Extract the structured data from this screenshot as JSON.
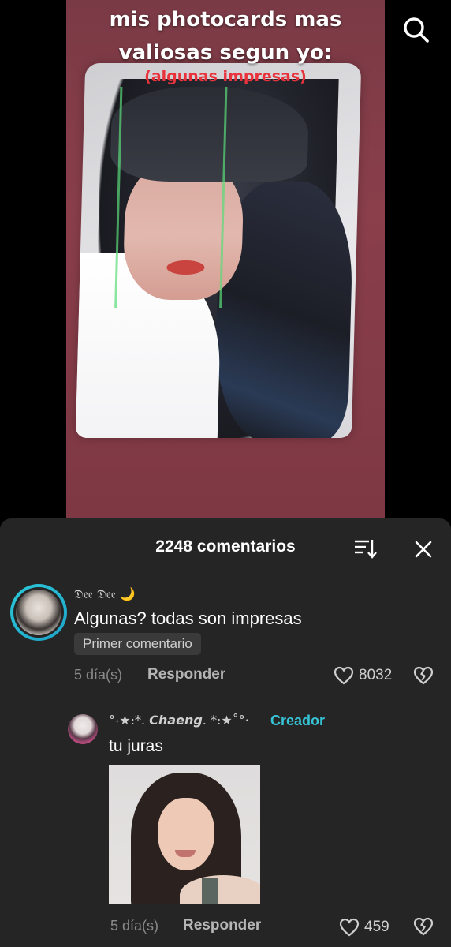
{
  "video": {
    "caption_line1": "mis photocards mas",
    "caption_line2": "valiosas segun yo:",
    "subcaption": "(algunas impresas)",
    "search_icon": "search-icon"
  },
  "comments_sheet": {
    "title": "2248 comentarios",
    "sort_icon": "sort-icon",
    "close_icon": "close-icon",
    "comments": [
      {
        "username": "𝔇𝔢𝔢 𝔇𝔢𝔢 🌙",
        "text": "Algunas? todas son impresas",
        "badge": "Primer comentario",
        "time": "5 día(s)",
        "reply_label": "Responder",
        "likes": "8032"
      },
      {
        "username": "°˖★:*. 𝘾𝙝𝙖𝙚𝙣𝙜. *:★˚°·",
        "creator_label": "Creador",
        "text": "tu juras",
        "time": "5 día(s)",
        "reply_label": "Responder",
        "likes": "459"
      }
    ]
  },
  "colors": {
    "sheet_bg": "#252525",
    "accent_creator": "#36c3d6",
    "avatar_ring": "#2bc9d9"
  }
}
